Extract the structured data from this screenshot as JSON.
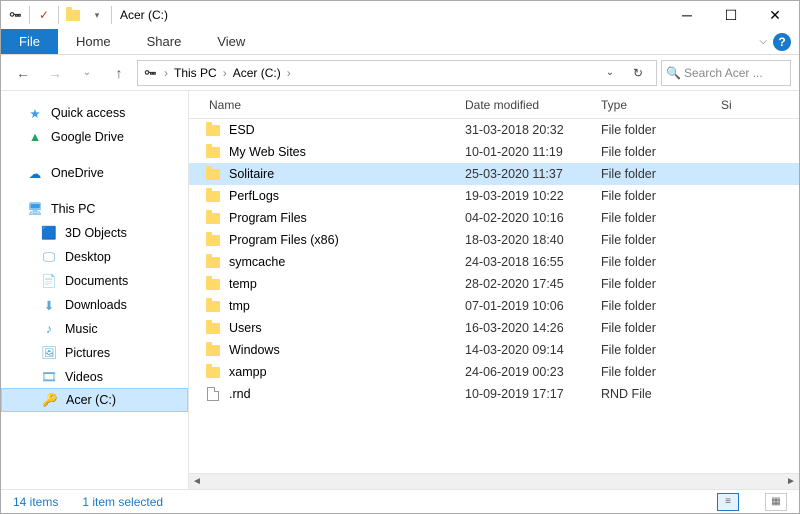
{
  "window": {
    "title": "Acer (C:)"
  },
  "ribbon": {
    "file": "File",
    "tabs": [
      "Home",
      "Share",
      "View"
    ]
  },
  "address": {
    "crumbs": [
      "This PC",
      "Acer (C:)"
    ],
    "search_placeholder": "Search Acer ..."
  },
  "sidebar": {
    "quick_access": "Quick access",
    "google_drive": "Google Drive",
    "onedrive": "OneDrive",
    "this_pc": "This PC",
    "children": [
      "3D Objects",
      "Desktop",
      "Documents",
      "Downloads",
      "Music",
      "Pictures",
      "Videos",
      "Acer (C:)"
    ]
  },
  "columns": {
    "name": "Name",
    "date": "Date modified",
    "type": "Type",
    "size": "Si"
  },
  "files": [
    {
      "name": "ESD",
      "date": "31-03-2018 20:32",
      "type": "File folder",
      "icon": "folder",
      "selected": false
    },
    {
      "name": "My Web Sites",
      "date": "10-01-2020 11:19",
      "type": "File folder",
      "icon": "folder",
      "selected": false
    },
    {
      "name": "Solitaire",
      "date": "25-03-2020 11:37",
      "type": "File folder",
      "icon": "folder",
      "selected": true
    },
    {
      "name": "PerfLogs",
      "date": "19-03-2019 10:22",
      "type": "File folder",
      "icon": "folder",
      "selected": false
    },
    {
      "name": "Program Files",
      "date": "04-02-2020 10:16",
      "type": "File folder",
      "icon": "folder",
      "selected": false
    },
    {
      "name": "Program Files (x86)",
      "date": "18-03-2020 18:40",
      "type": "File folder",
      "icon": "folder",
      "selected": false
    },
    {
      "name": "symcache",
      "date": "24-03-2018 16:55",
      "type": "File folder",
      "icon": "folder",
      "selected": false
    },
    {
      "name": "temp",
      "date": "28-02-2020 17:45",
      "type": "File folder",
      "icon": "folder",
      "selected": false
    },
    {
      "name": "tmp",
      "date": "07-01-2019 10:06",
      "type": "File folder",
      "icon": "folder",
      "selected": false
    },
    {
      "name": "Users",
      "date": "16-03-2020 14:26",
      "type": "File folder",
      "icon": "folder",
      "selected": false
    },
    {
      "name": "Windows",
      "date": "14-03-2020 09:14",
      "type": "File folder",
      "icon": "folder",
      "selected": false
    },
    {
      "name": "xampp",
      "date": "24-06-2019 00:23",
      "type": "File folder",
      "icon": "folder",
      "selected": false
    },
    {
      "name": ".rnd",
      "date": "10-09-2019 17:17",
      "type": "RND File",
      "icon": "file",
      "selected": false
    }
  ],
  "status": {
    "count": "14 items",
    "selected": "1 item selected"
  }
}
